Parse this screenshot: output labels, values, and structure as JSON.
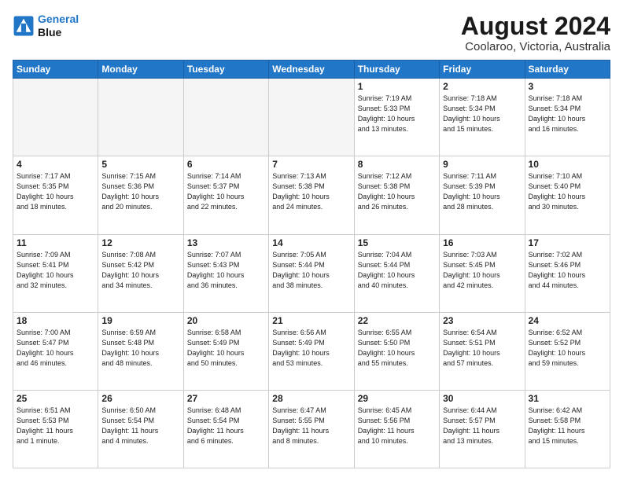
{
  "header": {
    "logo_line1": "General",
    "logo_line2": "Blue",
    "main_title": "August 2024",
    "subtitle": "Coolaroo, Victoria, Australia"
  },
  "weekdays": [
    "Sunday",
    "Monday",
    "Tuesday",
    "Wednesday",
    "Thursday",
    "Friday",
    "Saturday"
  ],
  "weeks": [
    [
      {
        "day": "",
        "info": ""
      },
      {
        "day": "",
        "info": ""
      },
      {
        "day": "",
        "info": ""
      },
      {
        "day": "",
        "info": ""
      },
      {
        "day": "1",
        "info": "Sunrise: 7:19 AM\nSunset: 5:33 PM\nDaylight: 10 hours\nand 13 minutes."
      },
      {
        "day": "2",
        "info": "Sunrise: 7:18 AM\nSunset: 5:34 PM\nDaylight: 10 hours\nand 15 minutes."
      },
      {
        "day": "3",
        "info": "Sunrise: 7:18 AM\nSunset: 5:34 PM\nDaylight: 10 hours\nand 16 minutes."
      }
    ],
    [
      {
        "day": "4",
        "info": "Sunrise: 7:17 AM\nSunset: 5:35 PM\nDaylight: 10 hours\nand 18 minutes."
      },
      {
        "day": "5",
        "info": "Sunrise: 7:15 AM\nSunset: 5:36 PM\nDaylight: 10 hours\nand 20 minutes."
      },
      {
        "day": "6",
        "info": "Sunrise: 7:14 AM\nSunset: 5:37 PM\nDaylight: 10 hours\nand 22 minutes."
      },
      {
        "day": "7",
        "info": "Sunrise: 7:13 AM\nSunset: 5:38 PM\nDaylight: 10 hours\nand 24 minutes."
      },
      {
        "day": "8",
        "info": "Sunrise: 7:12 AM\nSunset: 5:38 PM\nDaylight: 10 hours\nand 26 minutes."
      },
      {
        "day": "9",
        "info": "Sunrise: 7:11 AM\nSunset: 5:39 PM\nDaylight: 10 hours\nand 28 minutes."
      },
      {
        "day": "10",
        "info": "Sunrise: 7:10 AM\nSunset: 5:40 PM\nDaylight: 10 hours\nand 30 minutes."
      }
    ],
    [
      {
        "day": "11",
        "info": "Sunrise: 7:09 AM\nSunset: 5:41 PM\nDaylight: 10 hours\nand 32 minutes."
      },
      {
        "day": "12",
        "info": "Sunrise: 7:08 AM\nSunset: 5:42 PM\nDaylight: 10 hours\nand 34 minutes."
      },
      {
        "day": "13",
        "info": "Sunrise: 7:07 AM\nSunset: 5:43 PM\nDaylight: 10 hours\nand 36 minutes."
      },
      {
        "day": "14",
        "info": "Sunrise: 7:05 AM\nSunset: 5:44 PM\nDaylight: 10 hours\nand 38 minutes."
      },
      {
        "day": "15",
        "info": "Sunrise: 7:04 AM\nSunset: 5:44 PM\nDaylight: 10 hours\nand 40 minutes."
      },
      {
        "day": "16",
        "info": "Sunrise: 7:03 AM\nSunset: 5:45 PM\nDaylight: 10 hours\nand 42 minutes."
      },
      {
        "day": "17",
        "info": "Sunrise: 7:02 AM\nSunset: 5:46 PM\nDaylight: 10 hours\nand 44 minutes."
      }
    ],
    [
      {
        "day": "18",
        "info": "Sunrise: 7:00 AM\nSunset: 5:47 PM\nDaylight: 10 hours\nand 46 minutes."
      },
      {
        "day": "19",
        "info": "Sunrise: 6:59 AM\nSunset: 5:48 PM\nDaylight: 10 hours\nand 48 minutes."
      },
      {
        "day": "20",
        "info": "Sunrise: 6:58 AM\nSunset: 5:49 PM\nDaylight: 10 hours\nand 50 minutes."
      },
      {
        "day": "21",
        "info": "Sunrise: 6:56 AM\nSunset: 5:49 PM\nDaylight: 10 hours\nand 53 minutes."
      },
      {
        "day": "22",
        "info": "Sunrise: 6:55 AM\nSunset: 5:50 PM\nDaylight: 10 hours\nand 55 minutes."
      },
      {
        "day": "23",
        "info": "Sunrise: 6:54 AM\nSunset: 5:51 PM\nDaylight: 10 hours\nand 57 minutes."
      },
      {
        "day": "24",
        "info": "Sunrise: 6:52 AM\nSunset: 5:52 PM\nDaylight: 10 hours\nand 59 minutes."
      }
    ],
    [
      {
        "day": "25",
        "info": "Sunrise: 6:51 AM\nSunset: 5:53 PM\nDaylight: 11 hours\nand 1 minute."
      },
      {
        "day": "26",
        "info": "Sunrise: 6:50 AM\nSunset: 5:54 PM\nDaylight: 11 hours\nand 4 minutes."
      },
      {
        "day": "27",
        "info": "Sunrise: 6:48 AM\nSunset: 5:54 PM\nDaylight: 11 hours\nand 6 minutes."
      },
      {
        "day": "28",
        "info": "Sunrise: 6:47 AM\nSunset: 5:55 PM\nDaylight: 11 hours\nand 8 minutes."
      },
      {
        "day": "29",
        "info": "Sunrise: 6:45 AM\nSunset: 5:56 PM\nDaylight: 11 hours\nand 10 minutes."
      },
      {
        "day": "30",
        "info": "Sunrise: 6:44 AM\nSunset: 5:57 PM\nDaylight: 11 hours\nand 13 minutes."
      },
      {
        "day": "31",
        "info": "Sunrise: 6:42 AM\nSunset: 5:58 PM\nDaylight: 11 hours\nand 15 minutes."
      }
    ]
  ]
}
